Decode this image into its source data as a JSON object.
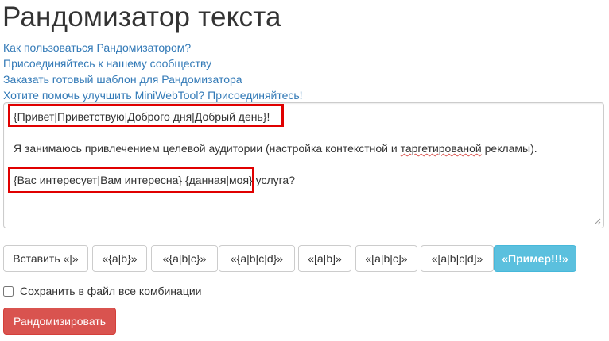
{
  "page": {
    "title": "Рандомизатор текста"
  },
  "links": [
    "Как пользоваться Рандомизатором?",
    "Присоединяйтесь к нашему сообществу",
    "Заказать готовый шаблон для Рандомизатора",
    "Хотите помочь улучшить MiniWebTool? Присоединяйтесь!"
  ],
  "editor": {
    "line1": "{Привет|Приветствую|Доброго дня|Добрый день}!",
    "line2_before": "Я занимаюсь привлечением целевой аудитории (настройка контекстной и ",
    "line2_misspelled": "таргетированой",
    "line2_after": " рекламы).",
    "line3": "{Вас интересует|Вам интересна} {данная|моя} услуга?"
  },
  "buttons": [
    "Вставить «|»",
    "«{a|b}»",
    "«{a|b|c}»",
    "«{a|b|c|d}»",
    "«[a|b]»",
    "«[a|b|c]»",
    "«[a|b|c|d]»",
    "«Пример!!!»"
  ],
  "checkbox": {
    "label": "Сохранить в файл все комбинации",
    "checked": false
  },
  "submit": {
    "label": "Рандомизировать"
  },
  "colors": {
    "link": "#337ab7",
    "highlight_border": "#e00000",
    "info_button": "#5bc0de",
    "danger_button": "#d9534f"
  }
}
